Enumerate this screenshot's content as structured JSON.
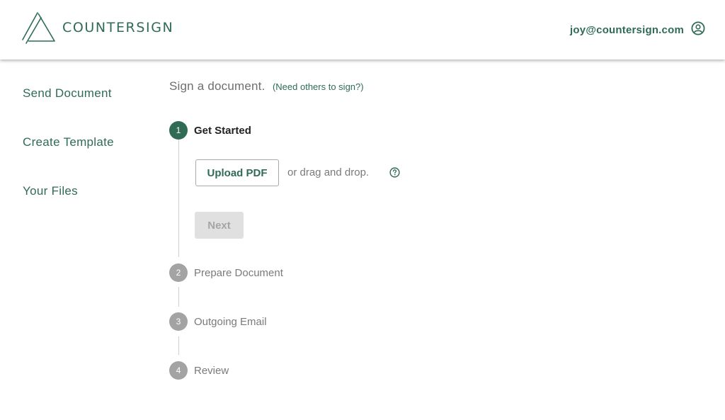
{
  "header": {
    "brand": "COUNTERSIGN",
    "user_email": "joy@countersign.com",
    "logo_icon": "countersign-logo-icon",
    "user_icon": "account-circle-icon"
  },
  "sidebar": {
    "items": [
      {
        "label": "Send Document"
      },
      {
        "label": "Create Template"
      },
      {
        "label": "Your Files"
      }
    ]
  },
  "main": {
    "title": "Sign a document.",
    "others_link": "(Need others to sign?)",
    "steps": [
      {
        "number": "1",
        "label": "Get Started",
        "active": true
      },
      {
        "number": "2",
        "label": "Prepare Document",
        "active": false
      },
      {
        "number": "3",
        "label": "Outgoing Email",
        "active": false
      },
      {
        "number": "4",
        "label": "Review",
        "active": false
      }
    ],
    "upload_label": "Upload PDF",
    "drag_text": "or drag and drop.",
    "help_icon": "help-circle-icon",
    "next_label": "Next"
  },
  "colors": {
    "brand_green": "#2f6b55",
    "inactive_step": "#a3a3a3",
    "disabled_button": "#e0e0e0"
  }
}
